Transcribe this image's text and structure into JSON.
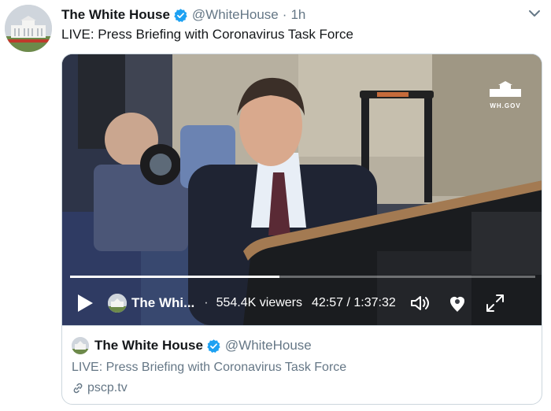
{
  "tweet": {
    "author_name": "The White House",
    "handle": "@WhiteHouse",
    "separator": "·",
    "time": "1h",
    "text": "LIVE: Press Briefing with Coronavirus Task Force"
  },
  "video": {
    "watermark_text": "WH.GOV",
    "progress_fraction": 0.45,
    "broadcaster_short": "The Whi...",
    "separator": "·",
    "viewers": "554.4K viewers",
    "time_display": "42:57 / 1:37:32"
  },
  "card": {
    "author_name": "The White House",
    "handle": "@WhiteHouse",
    "title": "LIVE: Press Briefing with Coronavirus Task Force",
    "link": "pscp.tv"
  },
  "colors": {
    "text_primary": "#14171a",
    "text_secondary": "#657786",
    "verified_blue": "#1da1f2",
    "border": "#ccd6dd"
  },
  "icons": [
    "verified-badge-icon",
    "chevron-down-icon",
    "play-icon",
    "volume-icon",
    "heart-icon",
    "fullscreen-icon",
    "link-icon"
  ]
}
